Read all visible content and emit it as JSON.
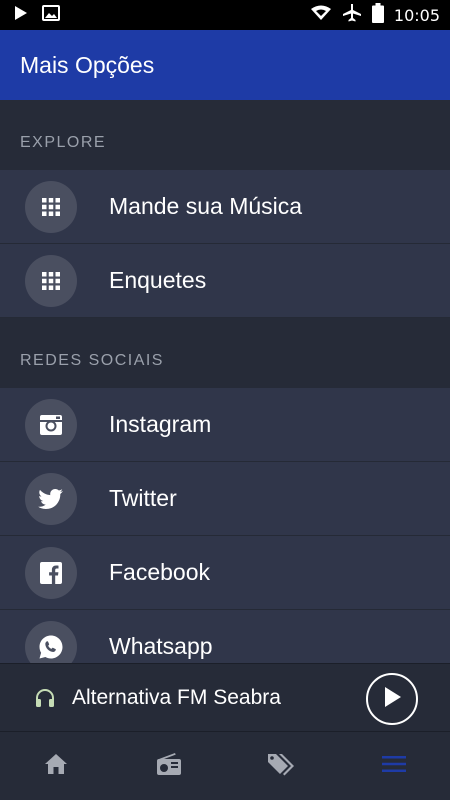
{
  "status_bar": {
    "time": "10:05",
    "icons": [
      "play-icon",
      "image-icon",
      "wifi-icon",
      "airplane-icon",
      "battery-icon"
    ]
  },
  "app_bar": {
    "title": "Mais Opções",
    "color": "#1e3ba6"
  },
  "sections": [
    {
      "header": "EXPLORE",
      "items": [
        {
          "label": "Mande sua Música",
          "icon": "grid-icon"
        },
        {
          "label": "Enquetes",
          "icon": "grid-icon"
        }
      ]
    },
    {
      "header": "REDES SOCIAIS",
      "items": [
        {
          "label": "Instagram",
          "icon": "instagram-icon"
        },
        {
          "label": "Twitter",
          "icon": "twitter-icon"
        },
        {
          "label": "Facebook",
          "icon": "facebook-icon"
        },
        {
          "label": "Whatsapp",
          "icon": "whatsapp-icon"
        }
      ]
    }
  ],
  "player": {
    "station": "Alternativa FM Seabra",
    "icon": "headphones-icon",
    "action_icon": "play-icon"
  },
  "bottom_nav": {
    "items": [
      {
        "icon": "home-icon",
        "active": false
      },
      {
        "icon": "radio-icon",
        "active": false
      },
      {
        "icon": "tags-icon",
        "active": false
      },
      {
        "icon": "menu-icon",
        "active": true
      }
    ],
    "active_color": "#1e3ba6",
    "inactive_color": "#a6aab3"
  }
}
